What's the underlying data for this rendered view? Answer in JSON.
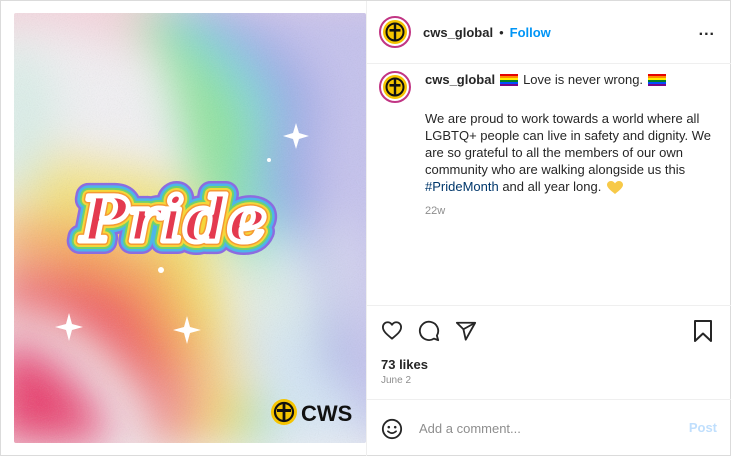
{
  "image": {
    "overlay_word": "Pride",
    "logo_text": "CWS"
  },
  "header": {
    "username": "cws_global",
    "separator": "•",
    "follow_label": "Follow",
    "more_label": "..."
  },
  "caption": {
    "username": "cws_global",
    "headline": "Love is never wrong.",
    "body_before_tag": "We are proud to work towards a world where all LGBTQ+ people can live in safety and dignity. We are so grateful to all the members of our own community who are walking alongside us this ",
    "hashtag": "#PrideMonth",
    "body_after_tag": " and all year long.",
    "time": "22w"
  },
  "actions": {
    "likes": "73 likes",
    "date": "June 2"
  },
  "comment": {
    "placeholder": "Add a comment...",
    "post_label": "Post"
  },
  "colors": {
    "follow": "#0095f6",
    "hashtag": "#00376b",
    "post_disabled": "#c0dffd",
    "logo_yellow": "#f5c400"
  },
  "icons": [
    "heart-icon",
    "comment-icon",
    "share-icon",
    "bookmark-icon",
    "emoji-icon",
    "more-icon",
    "rainbow-flag-emoji",
    "yellow-heart-emoji"
  ]
}
